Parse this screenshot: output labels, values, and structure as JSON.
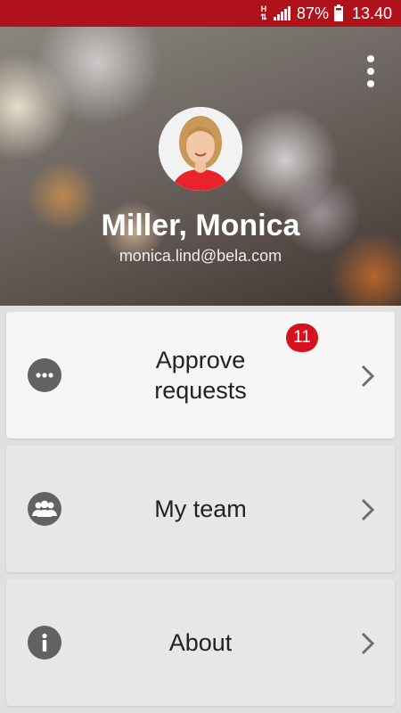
{
  "status_bar": {
    "network_letter": "H",
    "battery_percent": "87%",
    "time": "13.40"
  },
  "profile": {
    "name": "Miller, Monica",
    "email": "monica.lind@bela.com"
  },
  "menu": [
    {
      "label": "Approve\nrequests",
      "badge": "11",
      "icon": "more-dots-icon"
    },
    {
      "label": "My team",
      "icon": "team-icon"
    },
    {
      "label": "About",
      "icon": "info-icon"
    }
  ],
  "colors": {
    "status_bar": "#b0121b",
    "badge": "#d5121d",
    "icon_circle": "#626262"
  }
}
